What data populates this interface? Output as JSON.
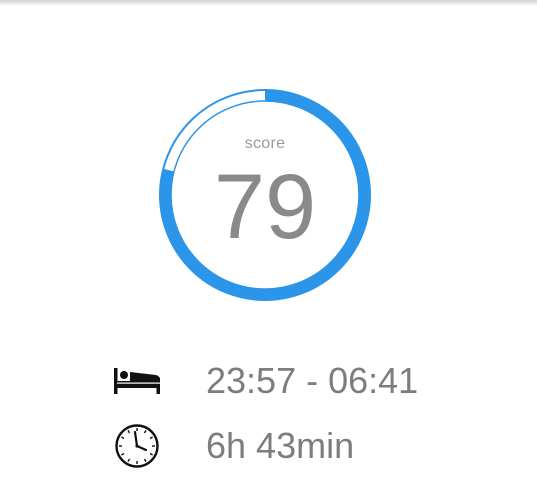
{
  "score": {
    "caption": "score",
    "value": "79",
    "progress": 0.79,
    "accent_color": "#2b95e9"
  },
  "sleep": {
    "bed_icon": "bed-icon",
    "time_range": "23:57 - 06:41",
    "clock_icon": "clock-icon",
    "duration": "6h 43min"
  }
}
